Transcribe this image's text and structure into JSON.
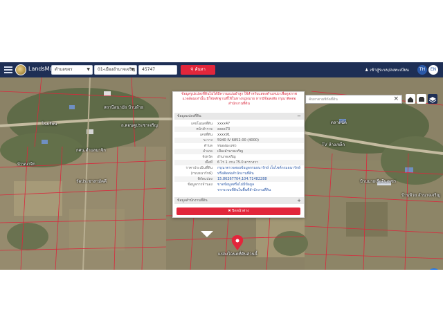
{
  "topbar": {
    "brand": "LandsMaps",
    "province_select": "ตำบลขจร",
    "district_select": "01-เมืองอำนาจเจริญ",
    "parcel_input": "45747",
    "search_label": "ค้นหา",
    "login_label": "เข้าสู่ระบบ/ลงทะเบียน",
    "lang_th": "TH",
    "lang_en": "EN"
  },
  "popup": {
    "warning": "ข้อมูลรูปแปลงที่ดินไม่ได้มีความแม่นยำสูง ใช้สำหรับแสดงตำแหน่ง เพื่อดูสภาพแวดล้อมเท่านั้น มิใช่หลักฐานที่ใช้ในทางกฎหมาย หากมีข้อสงสัย กรุณาติดต่อสำนักงานที่ดิน",
    "parcel_section_title": "ข้อมูลแปลงที่ดิน",
    "rows": [
      {
        "label": "เลขโฉนดที่ดิน",
        "value": "xxxx47"
      },
      {
        "label": "หน้าสำรวจ",
        "value": "xxxx73"
      },
      {
        "label": "เลขที่ดิน",
        "value": "xxxx91"
      },
      {
        "label": "ระวาง",
        "value": "5940 IV 6852-00 (4000)"
      },
      {
        "label": "ตำบล",
        "value": "หนองมะแซว"
      },
      {
        "label": "อำเภอ",
        "value": "เมืองอำนาจเจริญ"
      },
      {
        "label": "จังหวัด",
        "value": "อำนาจเจริญ"
      },
      {
        "label": "เนื้อที่",
        "value": "6 ไร่ 1 งาน 75.0 ตารางวา"
      },
      {
        "label": "ราคาประเมินที่ดิน",
        "value": "กรุณาตรวจสอบข้อมูลกรมธนารักษ์ เว็บไซต์กรมธนารักษ์"
      },
      {
        "label": "(กรมธนารักษ์)",
        "value": "หรือติดต่อสำนักงานที่ดิน"
      },
      {
        "label": "พิกัดแปลง",
        "value": "15.86267704,104.71482288"
      },
      {
        "label": "ข้อมูลการจำนอง",
        "value": "ขาดข้อมูลหรือไม่มีข้อมูล"
      },
      {
        "label": "",
        "value": "จากระบบที่ดินในพื้นที่สำนักงานที่ดิน"
      }
    ],
    "office_section_title": "ข้อมูลสำนักงานที่ดิน",
    "close_label": "✖ ปิดหน้าต่าง"
  },
  "map": {
    "search_placeholder": "ค้นหาตามพิกัดที่ดิน",
    "pin_label": "แปลงโฉนดที่ดินส่วนนี้",
    "places": [
      {
        "name": "สถานีอนามัย บ้านห้วย"
      },
      {
        "name": "ถ.ดอนคูประชาเจริญ"
      },
      {
        "name": "โรงเรียน"
      },
      {
        "name": "กศน.ตำบลนาจิก"
      },
      {
        "name": "บ้านนาจิก"
      },
      {
        "name": "วัดประชาสามัคคี"
      },
      {
        "name": "TV ห้างเหล็ก"
      },
      {
        "name": "ตลาดนัด"
      },
      {
        "name": "บ้านนายเรือจีนเพชร"
      },
      {
        "name": "บ้านห้วย อำนาจเจริญ"
      }
    ]
  },
  "colors": {
    "topbar": "#1e2f55",
    "accent_red": "#e2263b",
    "link_blue": "#2b59a8",
    "parcel_line": "#d9283c"
  }
}
